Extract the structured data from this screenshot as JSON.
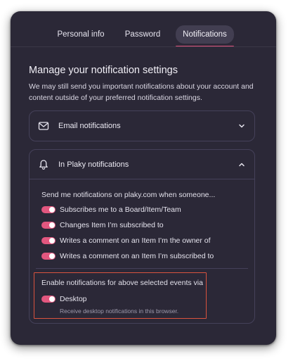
{
  "tabs": {
    "personal_info": "Personal info",
    "password": "Password",
    "notifications": "Notifications",
    "active": "notifications"
  },
  "main": {
    "heading": "Manage your notification settings",
    "intro": "We may still send you important notifications about your account and content outside of your preferred notification settings."
  },
  "email_section": {
    "title": "Email notifications",
    "icon": "envelope-icon",
    "state": "collapsed"
  },
  "inapp_section": {
    "title": "In Plaky notifications",
    "icon": "bell-icon",
    "state": "expanded",
    "subheading": "Send me notifications on plaky.com when someone...",
    "options": [
      {
        "label": "Subscribes me to a Board/Item/Team",
        "on": true
      },
      {
        "label": "Changes Item I’m subscribed to",
        "on": true
      },
      {
        "label": "Writes a comment on an Item I’m the owner of",
        "on": true
      },
      {
        "label": "Writes a comment on an Item I’m subscribed to",
        "on": true
      }
    ],
    "enable_text": "Enable notifications for above selected events via",
    "desktop": {
      "label": "Desktop",
      "on": true,
      "help": "Receive desktop notifications in this browser."
    }
  },
  "colors": {
    "panel_bg": "#2b2837",
    "toggle_on": "#e2577f",
    "active_tab_underline": "#e0527b",
    "highlight_border": "#d9533e"
  }
}
